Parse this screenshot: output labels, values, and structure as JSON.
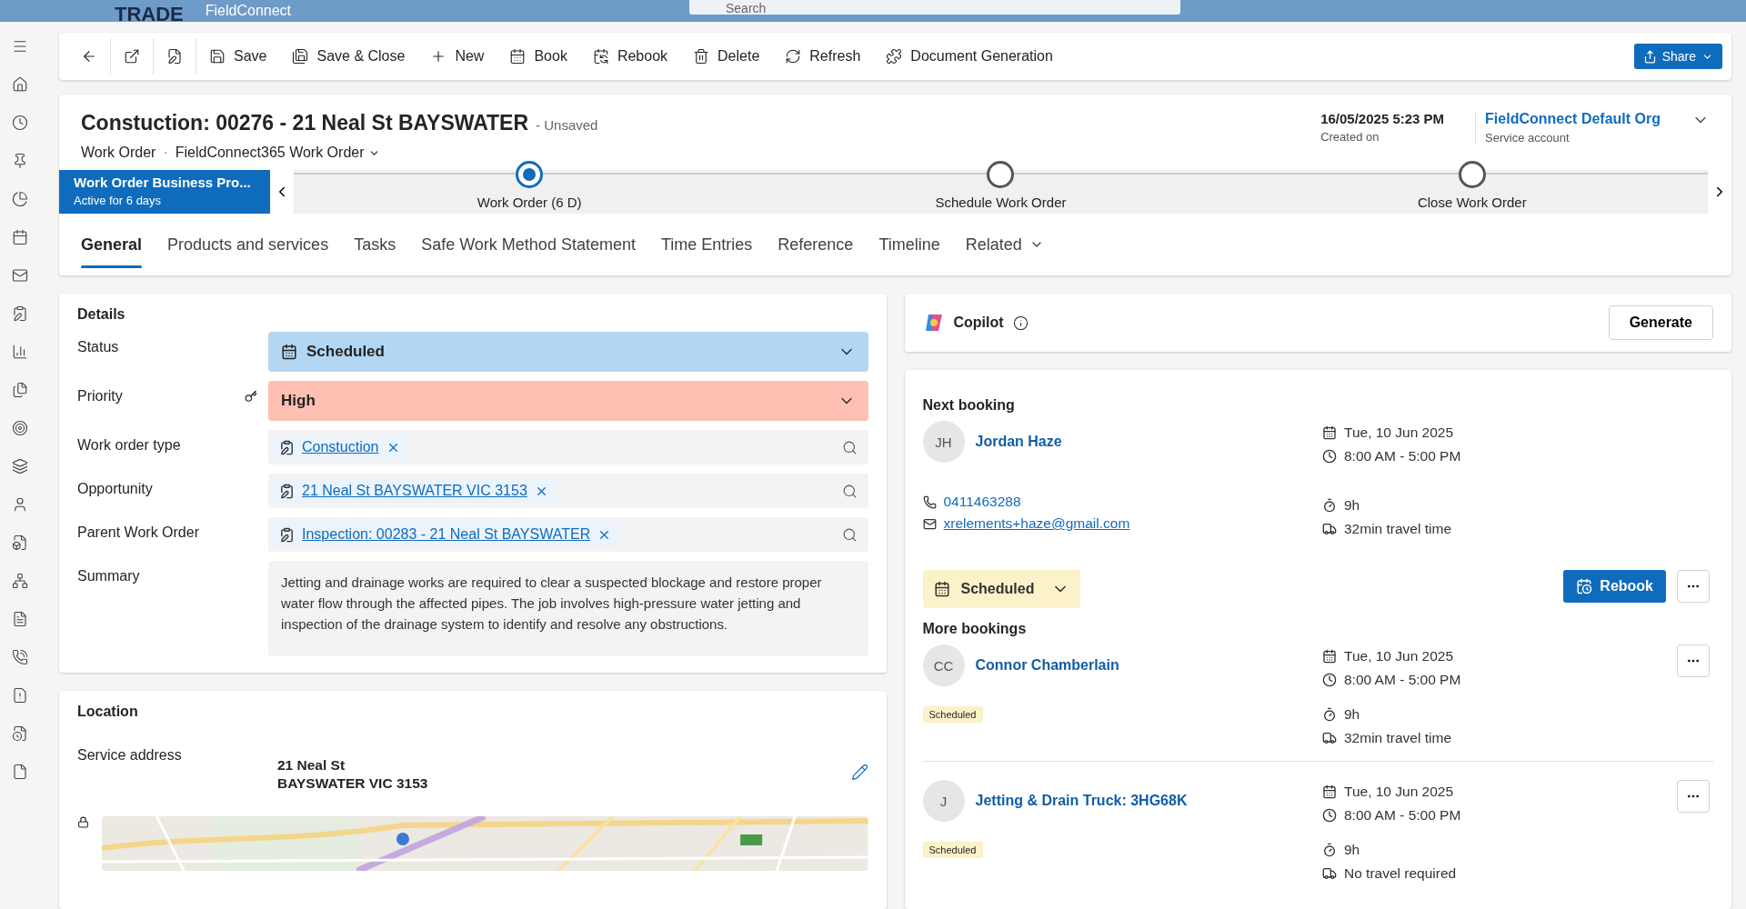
{
  "app_bar": {
    "brand": "TRADE",
    "app_name": "FieldConnect",
    "search_placeholder": "Search"
  },
  "toolbar": [
    {
      "kind": "icon"
    },
    {
      "kind": "icon"
    },
    {
      "kind": "icon"
    },
    {
      "kind": "labeled",
      "label": "Save"
    },
    {
      "kind": "labeled",
      "label": "Save & Close"
    },
    {
      "kind": "labeled",
      "label": "New"
    },
    {
      "kind": "labeled",
      "label": "Book"
    },
    {
      "kind": "labeled",
      "label": "Rebook"
    },
    {
      "kind": "labeled",
      "label": "Delete"
    },
    {
      "kind": "labeled",
      "label": "Refresh"
    },
    {
      "kind": "labeled",
      "label": "Document Generation"
    }
  ],
  "share": "Share",
  "record": {
    "title": "Constuction: 00276 - 21 Neal St BAYSWATER",
    "unsaved": "- Unsaved",
    "entity": "Work Order",
    "separator": "·",
    "form": "FieldConnect365 Work Order",
    "created_value": "16/05/2025 5:23 PM",
    "created_label": "Created on",
    "owner": "FieldConnect Default Org",
    "owner_label": "Service account"
  },
  "process": {
    "name": "Work Order Business Pro...",
    "duration": "Active for 6 days",
    "stages": [
      {
        "label": "Work Order  (6 D)",
        "selected": true
      },
      {
        "label": "Schedule Work Order",
        "selected": false
      },
      {
        "label": "Close Work Order",
        "selected": false
      }
    ]
  },
  "tabs": [
    {
      "label": "General",
      "selected": true
    },
    {
      "label": "Products and services",
      "selected": false
    },
    {
      "label": "Tasks",
      "selected": false
    },
    {
      "label": "Safe Work Method Statement",
      "selected": false
    },
    {
      "label": "Time Entries",
      "selected": false
    },
    {
      "label": "Reference",
      "selected": false
    },
    {
      "label": "Timeline",
      "selected": false
    },
    {
      "label": "Related",
      "selected": false
    }
  ],
  "details": {
    "title": "Details",
    "fields": [
      {
        "kind": "option",
        "label": "Status",
        "value": "Scheduled",
        "color": "#b3d6f2",
        "secured": false
      },
      {
        "kind": "option",
        "label": "Priority",
        "value": "High",
        "color": "#fdc0b2",
        "secured": true
      },
      {
        "kind": "lookup",
        "label": "Work order type",
        "value": "Constuction",
        "secured": false
      },
      {
        "kind": "lookup",
        "label": "Opportunity",
        "value": "21 Neal St BAYSWATER VIC 3153",
        "secured": false
      },
      {
        "kind": "lookup",
        "label": "Parent Work Order",
        "value": "Inspection: 00283 - 21 Neal St BAYSWATER",
        "secured": false
      },
      {
        "kind": "text",
        "label": "Summary",
        "value": "Jetting and drainage works are required to clear a suspected blockage and restore proper water flow through the affected pipes. The job involves high-pressure water jetting and inspection of the drainage system to identify and resolve any obstructions.",
        "secured": false
      }
    ]
  },
  "location": {
    "title": "Location",
    "label": "Service address",
    "lines": [
      "21 Neal St",
      "BAYSWATER VIC 3153"
    ],
    "map": {
      "kind": "picture"
    }
  },
  "copilot": {
    "title": "Copilot",
    "button": "Generate"
  },
  "next_booking": {
    "title": "Next booking",
    "initials": "JH",
    "name": "Jordan Haze",
    "phone": "0411463288",
    "email": "xrelements+haze@gmail.com",
    "date": "Tue, 10 Jun 2025",
    "time": "8:00 AM - 5:00 PM",
    "duration": "9h",
    "travel": "32min travel time",
    "status": "Scheduled",
    "rebook": "Rebook"
  },
  "more_bookings": {
    "title": "More bookings",
    "items": [
      {
        "initials": "CC",
        "name": "Connor Chamberlain",
        "status": "Scheduled",
        "date": "Tue, 10 Jun 2025",
        "time": "8:00 AM - 5:00 PM",
        "duration": "9h",
        "travel": "32min travel time"
      },
      {
        "initials": "J",
        "name": "Jetting & Drain Truck: 3HG68K",
        "status": "Scheduled",
        "date": "Tue, 10 Jun 2025",
        "time": "8:00 AM - 5:00 PM",
        "duration": "9h",
        "travel": "No travel required"
      }
    ]
  }
}
